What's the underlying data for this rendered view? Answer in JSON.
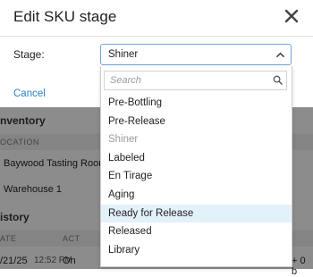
{
  "background": {
    "inventory_title": "nventory",
    "location_label": "OCATION",
    "locations": [
      "Baywood Tasting Room",
      "Warehouse 1"
    ],
    "history_title": "istory",
    "date_label": "ATE",
    "act_label": "ACT",
    "history_row": {
      "date": "/21/25",
      "time": "12:52 PM",
      "text": "On"
    },
    "history_row_right": "+ 0 b"
  },
  "modal": {
    "title": "Edit SKU stage",
    "stage_label": "Stage:",
    "selected_value": "Shiner",
    "cancel_label": "Cancel"
  },
  "dropdown": {
    "search_placeholder": "Search",
    "options": [
      {
        "label": "Pre-Bottling",
        "state": "normal"
      },
      {
        "label": "Pre-Release",
        "state": "normal"
      },
      {
        "label": "Shiner",
        "state": "disabled"
      },
      {
        "label": "Labeled",
        "state": "normal"
      },
      {
        "label": "En Tirage",
        "state": "normal"
      },
      {
        "label": "Aging",
        "state": "normal"
      },
      {
        "label": "Ready for Release",
        "state": "hover"
      },
      {
        "label": "Released",
        "state": "normal"
      },
      {
        "label": "Library",
        "state": "normal"
      }
    ]
  },
  "colors": {
    "accent": "#2a83c5",
    "focus_border": "#6fa6d8",
    "hover_bg": "#e3f1fb",
    "confirm_green": "#38a85a"
  }
}
